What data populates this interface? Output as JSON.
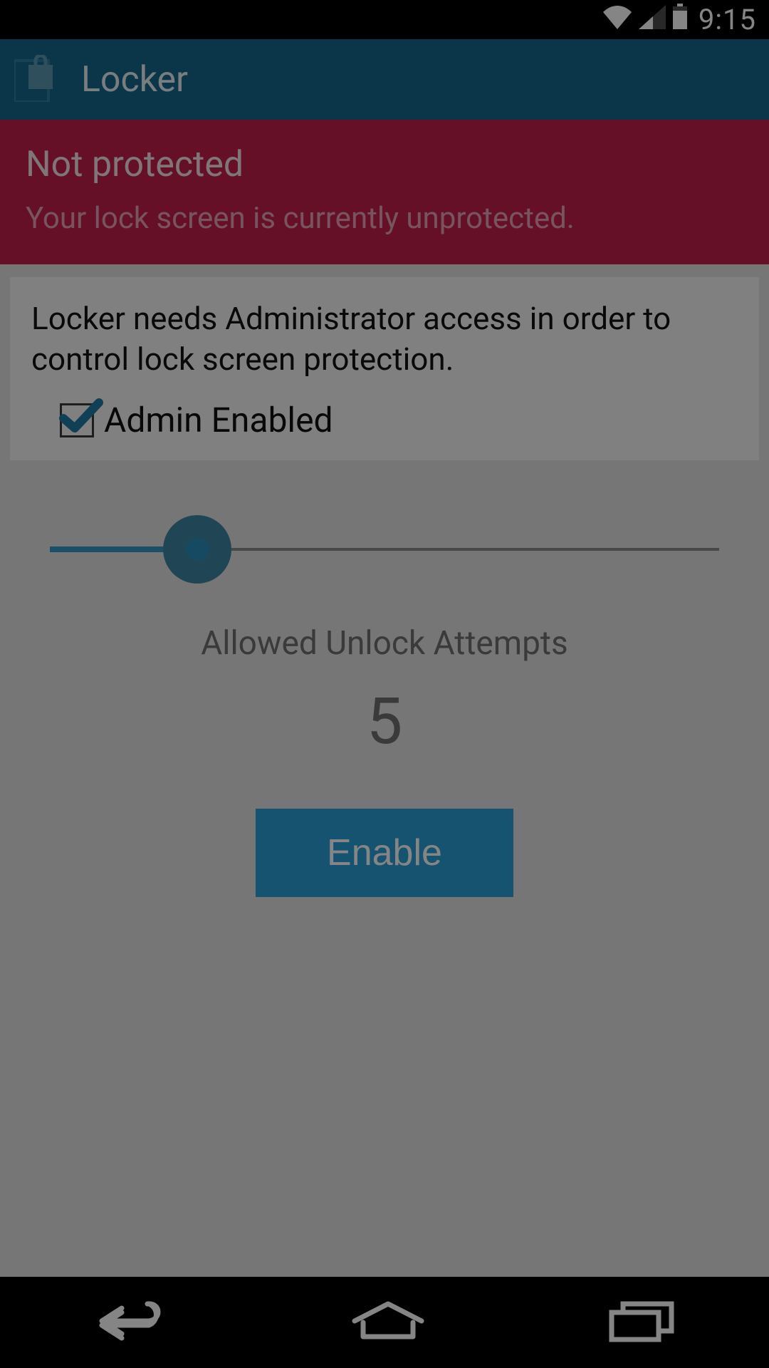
{
  "status_bar": {
    "clock": "9:15"
  },
  "action_bar": {
    "title": "Locker"
  },
  "warning": {
    "title": "Not protected",
    "subtitle": "Your lock screen is currently unprotected."
  },
  "admin_card": {
    "message": "Locker needs Administrator access in order to control lock screen protection.",
    "checkbox_label": "Admin Enabled",
    "checkbox_checked": true
  },
  "slider": {
    "label": "Allowed Unlock Attempts",
    "value": "5",
    "percent": 22
  },
  "enable_button": {
    "label": "Enable"
  },
  "colors": {
    "accent": "#2ba0d6",
    "actionbar": "#16678c",
    "danger": "#c41f4e"
  }
}
